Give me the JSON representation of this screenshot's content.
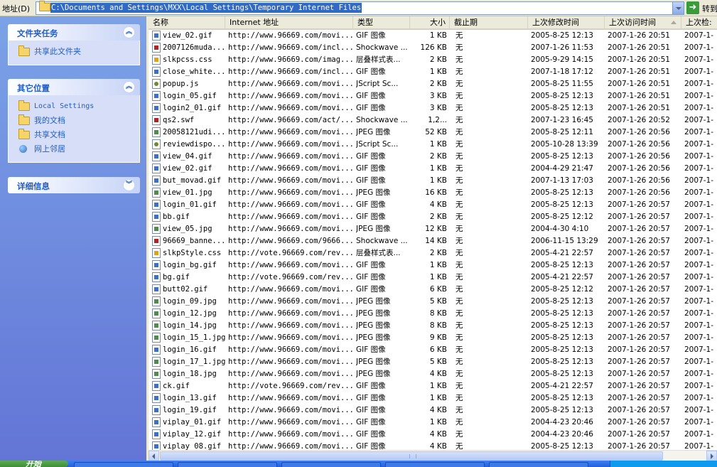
{
  "address_bar": {
    "label": "地址(D)",
    "path": "C:\\Documents and Settings\\MXX\\Local Settings\\Temporary Internet Files",
    "go_label": "转到"
  },
  "task_pane": {
    "file_tasks": {
      "title": "文件夹任务",
      "items": [
        "共享此文件夹"
      ]
    },
    "other_places": {
      "title": "其它位置",
      "items": [
        "Local Settings",
        "我的文档",
        "共享文档",
        "网上邻居"
      ]
    },
    "details": {
      "title": "详细信息"
    }
  },
  "columns": {
    "name": "名称",
    "url": "Internet 地址",
    "type": "类型",
    "size": "大小",
    "expires": "截止期",
    "modified": "上次修改时间",
    "accessed": "上次访问时间",
    "checked": "上次检:"
  },
  "files": [
    {
      "name": "view_02.gif",
      "url": "http://www.96669.com/movi...",
      "type": "GIF 图像",
      "size": "1 KB",
      "exp": "无",
      "mod": "2005-8-25 12:13",
      "acc": "2007-1-26 20:51",
      "chk": "2007-1-",
      "icon": "gif"
    },
    {
      "name": "2007126muda...",
      "url": "http://www.96669.com/incl...",
      "type": "Shockwave ...",
      "size": "126 KB",
      "exp": "无",
      "mod": "2007-1-26 11:53",
      "acc": "2007-1-26 20:51",
      "chk": "2007-1-",
      "icon": "swf"
    },
    {
      "name": "slkpcss.css",
      "url": "http://www.96669.com/imag...",
      "type": "层叠样式表...",
      "size": "2 KB",
      "exp": "无",
      "mod": "2005-9-29 14:15",
      "acc": "2007-1-26 20:51",
      "chk": "2007-1-",
      "icon": "css"
    },
    {
      "name": "close_white...",
      "url": "http://www.96669.com/incl...",
      "type": "GIF 图像",
      "size": "1 KB",
      "exp": "无",
      "mod": "2007-1-18 17:12",
      "acc": "2007-1-26 20:51",
      "chk": "2007-1-",
      "icon": "gif"
    },
    {
      "name": "popup.js",
      "url": "http://www.96669.com/movi...",
      "type": "JScript Sc...",
      "size": "2 KB",
      "exp": "无",
      "mod": "2005-8-25 11:55",
      "acc": "2007-1-26 20:51",
      "chk": "2007-1-",
      "icon": "js"
    },
    {
      "name": "login_05.gif",
      "url": "http://www.96669.com/movi...",
      "type": "GIF 图像",
      "size": "3 KB",
      "exp": "无",
      "mod": "2005-8-25 12:13",
      "acc": "2007-1-26 20:51",
      "chk": "2007-1-",
      "icon": "gif"
    },
    {
      "name": "login2_01.gif",
      "url": "http://www.96669.com/movi...",
      "type": "GIF 图像",
      "size": "3 KB",
      "exp": "无",
      "mod": "2005-8-25 12:13",
      "acc": "2007-1-26 20:51",
      "chk": "2007-1-",
      "icon": "gif"
    },
    {
      "name": "qs2.swf",
      "url": "http://www.96669.com/act/...",
      "type": "Shockwave ...",
      "size": "1,2...",
      "exp": "无",
      "mod": "2007-1-23 16:45",
      "acc": "2007-1-26 20:52",
      "chk": "2007-1-",
      "icon": "swf"
    },
    {
      "name": "20058121udi...",
      "url": "http://www.96669.com/movi...",
      "type": "JPEG 图像",
      "size": "52 KB",
      "exp": "无",
      "mod": "2005-8-25 12:11",
      "acc": "2007-1-26 20:56",
      "chk": "2007-1-",
      "icon": "jpg"
    },
    {
      "name": "reviewdispo...",
      "url": "http://www.96669.com/movi...",
      "type": "JScript Sc...",
      "size": "1 KB",
      "exp": "无",
      "mod": "2005-10-28 13:39",
      "acc": "2007-1-26 20:56",
      "chk": "2007-1-",
      "icon": "js"
    },
    {
      "name": "view_04.gif",
      "url": "http://www.96669.com/movi...",
      "type": "GIF 图像",
      "size": "2 KB",
      "exp": "无",
      "mod": "2005-8-25 12:13",
      "acc": "2007-1-26 20:56",
      "chk": "2007-1-",
      "icon": "gif"
    },
    {
      "name": "view_02.gif",
      "url": "http://www.96669.com/movi...",
      "type": "GIF 图像",
      "size": "1 KB",
      "exp": "无",
      "mod": "2004-4-29 21:47",
      "acc": "2007-1-26 20:56",
      "chk": "2007-1-",
      "icon": "gif"
    },
    {
      "name": "but_movad.gif",
      "url": "http://www.96669.com/movi...",
      "type": "GIF 图像",
      "size": "1 KB",
      "exp": "无",
      "mod": "2007-1-13 17:03",
      "acc": "2007-1-26 20:56",
      "chk": "2007-1-",
      "icon": "gif"
    },
    {
      "name": "view_01.jpg",
      "url": "http://www.96669.com/movi...",
      "type": "JPEG 图像",
      "size": "16 KB",
      "exp": "无",
      "mod": "2005-8-25 12:13",
      "acc": "2007-1-26 20:56",
      "chk": "2007-1-",
      "icon": "jpg"
    },
    {
      "name": "login_01.gif",
      "url": "http://www.96669.com/movi...",
      "type": "GIF 图像",
      "size": "4 KB",
      "exp": "无",
      "mod": "2005-8-25 12:13",
      "acc": "2007-1-26 20:57",
      "chk": "2007-1-",
      "icon": "gif"
    },
    {
      "name": "bb.gif",
      "url": "http://www.96669.com/movi...",
      "type": "GIF 图像",
      "size": "2 KB",
      "exp": "无",
      "mod": "2005-8-25 12:12",
      "acc": "2007-1-26 20:57",
      "chk": "2007-1-",
      "icon": "gif"
    },
    {
      "name": "view_05.jpg",
      "url": "http://www.96669.com/movi...",
      "type": "JPEG 图像",
      "size": "12 KB",
      "exp": "无",
      "mod": "2004-4-30 4:10",
      "acc": "2007-1-26 20:57",
      "chk": "2007-1-",
      "icon": "jpg"
    },
    {
      "name": "96669_banne...",
      "url": "http://www.96669.com/9666...",
      "type": "Shockwave ...",
      "size": "14 KB",
      "exp": "无",
      "mod": "2006-11-15 13:29",
      "acc": "2007-1-26 20:57",
      "chk": "2007-1-",
      "icon": "swf"
    },
    {
      "name": "slkpStyle.css",
      "url": "http://vote.96669.com/rev...",
      "type": "层叠样式表...",
      "size": "2 KB",
      "exp": "无",
      "mod": "2005-4-21 22:57",
      "acc": "2007-1-26 20:57",
      "chk": "2007-1-",
      "icon": "css"
    },
    {
      "name": "login_bg.gif",
      "url": "http://www.96669.com/movi...",
      "type": "GIF 图像",
      "size": "1 KB",
      "exp": "无",
      "mod": "2005-8-25 12:13",
      "acc": "2007-1-26 20:57",
      "chk": "2007-1-",
      "icon": "gif"
    },
    {
      "name": "bg.gif",
      "url": "http://vote.96669.com/rev...",
      "type": "GIF 图像",
      "size": "1 KB",
      "exp": "无",
      "mod": "2005-4-21 22:57",
      "acc": "2007-1-26 20:57",
      "chk": "2007-1-",
      "icon": "gif"
    },
    {
      "name": "butt02.gif",
      "url": "http://www.96669.com/movi...",
      "type": "GIF 图像",
      "size": "6 KB",
      "exp": "无",
      "mod": "2005-8-25 12:12",
      "acc": "2007-1-26 20:57",
      "chk": "2007-1-",
      "icon": "gif"
    },
    {
      "name": "login_09.jpg",
      "url": "http://www.96669.com/movi...",
      "type": "JPEG 图像",
      "size": "5 KB",
      "exp": "无",
      "mod": "2005-8-25 12:13",
      "acc": "2007-1-26 20:57",
      "chk": "2007-1-",
      "icon": "jpg"
    },
    {
      "name": "login_12.jpg",
      "url": "http://www.96669.com/movi...",
      "type": "JPEG 图像",
      "size": "8 KB",
      "exp": "无",
      "mod": "2005-8-25 12:13",
      "acc": "2007-1-26 20:57",
      "chk": "2007-1-",
      "icon": "jpg"
    },
    {
      "name": "login_14.jpg",
      "url": "http://www.96669.com/movi...",
      "type": "JPEG 图像",
      "size": "8 KB",
      "exp": "无",
      "mod": "2005-8-25 12:13",
      "acc": "2007-1-26 20:57",
      "chk": "2007-1-",
      "icon": "jpg"
    },
    {
      "name": "login_15_1.jpg",
      "url": "http://www.96669.com/movi...",
      "type": "JPEG 图像",
      "size": "9 KB",
      "exp": "无",
      "mod": "2005-8-25 12:13",
      "acc": "2007-1-26 20:57",
      "chk": "2007-1-",
      "icon": "jpg"
    },
    {
      "name": "login_16.gif",
      "url": "http://www.96669.com/movi...",
      "type": "GIF 图像",
      "size": "6 KB",
      "exp": "无",
      "mod": "2005-8-25 12:13",
      "acc": "2007-1-26 20:57",
      "chk": "2007-1-",
      "icon": "gif"
    },
    {
      "name": "login_17_1.jpg",
      "url": "http://www.96669.com/movi...",
      "type": "JPEG 图像",
      "size": "5 KB",
      "exp": "无",
      "mod": "2005-8-25 12:13",
      "acc": "2007-1-26 20:57",
      "chk": "2007-1-",
      "icon": "jpg"
    },
    {
      "name": "login_18.jpg",
      "url": "http://www.96669.com/movi...",
      "type": "JPEG 图像",
      "size": "4 KB",
      "exp": "无",
      "mod": "2005-8-25 12:13",
      "acc": "2007-1-26 20:57",
      "chk": "2007-1-",
      "icon": "jpg"
    },
    {
      "name": "ck.gif",
      "url": "http://vote.96669.com/rev...",
      "type": "GIF 图像",
      "size": "1 KB",
      "exp": "无",
      "mod": "2005-4-21 22:57",
      "acc": "2007-1-26 20:57",
      "chk": "2007-1-",
      "icon": "gif"
    },
    {
      "name": "login_13.gif",
      "url": "http://www.96669.com/movi...",
      "type": "GIF 图像",
      "size": "1 KB",
      "exp": "无",
      "mod": "2005-8-25 12:13",
      "acc": "2007-1-26 20:57",
      "chk": "2007-1-",
      "icon": "gif"
    },
    {
      "name": "login_19.gif",
      "url": "http://www.96669.com/movi...",
      "type": "GIF 图像",
      "size": "4 KB",
      "exp": "无",
      "mod": "2005-8-25 12:13",
      "acc": "2007-1-26 20:57",
      "chk": "2007-1-",
      "icon": "gif"
    },
    {
      "name": "viplay_01.gif",
      "url": "http://www.96669.com/movi...",
      "type": "GIF 图像",
      "size": "1 KB",
      "exp": "无",
      "mod": "2004-4-23 20:46",
      "acc": "2007-1-26 20:57",
      "chk": "2007-1-",
      "icon": "gif"
    },
    {
      "name": "viplay_12.gif",
      "url": "http://www.96669.com/movi...",
      "type": "GIF 图像",
      "size": "4 KB",
      "exp": "无",
      "mod": "2004-4-23 20:46",
      "acc": "2007-1-26 20:57",
      "chk": "2007-1-",
      "icon": "gif"
    },
    {
      "name": "viplay_08.gif",
      "url": "http://www.96669.com/movi...",
      "type": "GIF 图像",
      "size": "4 KB",
      "exp": "无",
      "mod": "2005-8-25 12:13",
      "acc": "2007-1-26 20:57",
      "chk": "2007-1-",
      "icon": "gif"
    }
  ],
  "taskbar": {
    "start_label": "开始"
  }
}
